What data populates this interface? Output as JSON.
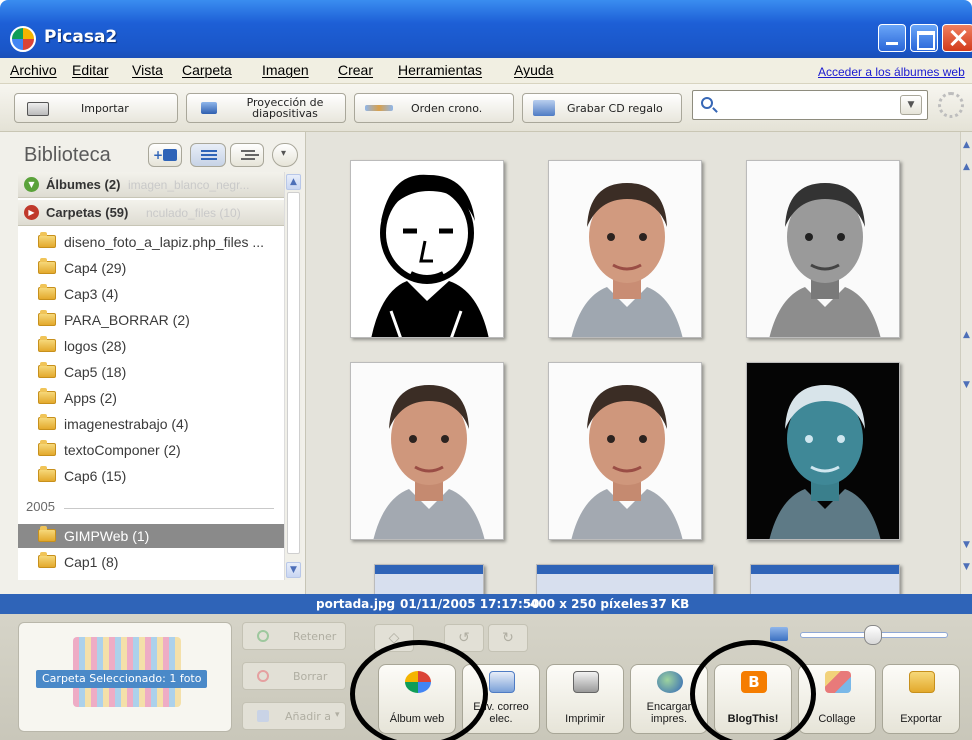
{
  "window": {
    "title": "Picasa2"
  },
  "menu": {
    "items": [
      "Archivo",
      "Editar",
      "Vista",
      "Carpeta",
      "Imagen",
      "Crear",
      "Herramientas",
      "Ayuda"
    ],
    "link": "Acceder a los álbumes web"
  },
  "toolbar": {
    "import_label": "Importar",
    "slideshow_label": "Proyección de diapositivas",
    "timeline_label": "Orden crono.",
    "gift_cd_label": "Grabar CD regalo",
    "search_value": ""
  },
  "library": {
    "title": "Biblioteca",
    "groups": [
      {
        "label": "Álbumes (2)",
        "ghost": "imagen_blanco_negr..."
      },
      {
        "label": "Carpetas (59)",
        "ghost": "nculado_files (10)"
      }
    ],
    "folders": [
      "diseno_foto_a_lapiz.php_files ...",
      "Cap4 (29)",
      "Cap3 (4)",
      "PARA_BORRAR (2)",
      "logos (28)",
      "Cap5 (18)",
      "Apps (2)",
      "imagenestrabajo (4)",
      "textoComponer (2)",
      "Cap6 (15)"
    ],
    "year": "2005",
    "year_folders": [
      "GIMPWeb (1)",
      "Cap1 (8)"
    ],
    "selected": "GIMPWeb (1)"
  },
  "status": {
    "filename": "portada.jpg",
    "datetime": "01/11/2005 17:17:50",
    "dimensions": "400 x 250 píxeles",
    "size": "37 KB"
  },
  "tray": {
    "selection_label": "Carpeta Seleccionado: 1 foto",
    "hold_label": "Retener",
    "clear_label": "Borrar",
    "add_label": "Añadir a"
  },
  "actions": {
    "web_album": "Álbum web",
    "email": "Env. correo elec.",
    "print": "Imprimir",
    "order_prints": "Encargar impres.",
    "blogthis": "BlogThis!",
    "collage": "Collage",
    "export": "Exportar"
  },
  "colors": {
    "titlebar": "#1d5fd6",
    "statusbar": "#2f64b8",
    "selected_folder": "#8a8a8a",
    "link": "#1a1ad0"
  }
}
